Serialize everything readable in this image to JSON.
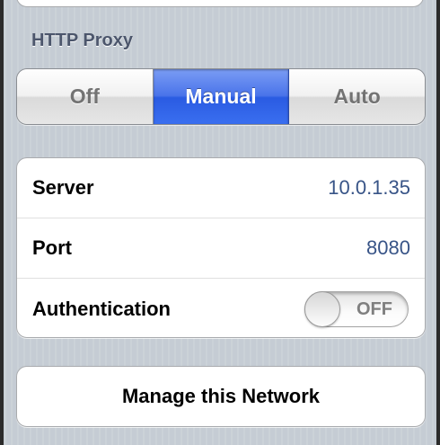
{
  "http_proxy": {
    "header": "HTTP Proxy",
    "segments": [
      {
        "label": "Off",
        "selected": false
      },
      {
        "label": "Manual",
        "selected": true
      },
      {
        "label": "Auto",
        "selected": false
      }
    ],
    "selected_color": "#3a6ff0"
  },
  "settings": {
    "server": {
      "label": "Server",
      "value": "10.0.1.35"
    },
    "port": {
      "label": "Port",
      "value": "8080"
    },
    "authentication": {
      "label": "Authentication",
      "toggle_text": "OFF",
      "enabled": false
    }
  },
  "manage": {
    "label": "Manage this Network"
  },
  "colors": {
    "value_text": "#385487",
    "header_text": "#4c566c",
    "background": "#c5ccd4"
  }
}
